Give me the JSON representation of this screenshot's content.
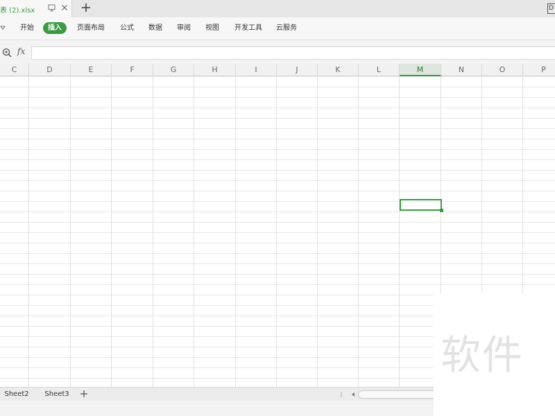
{
  "tabbar": {
    "doc_title": "表 (2).xlsx",
    "corner_label": "D"
  },
  "menu": {
    "items": [
      {
        "label": "开始"
      },
      {
        "label": "插入",
        "active": true
      },
      {
        "label": "页面布局"
      },
      {
        "label": "公式"
      },
      {
        "label": "数据"
      },
      {
        "label": "审阅"
      },
      {
        "label": "视图"
      },
      {
        "label": "开发工具"
      },
      {
        "label": "云服务"
      }
    ]
  },
  "formula": {
    "fx_label": "fx",
    "value": ""
  },
  "columns": [
    "C",
    "D",
    "E",
    "F",
    "G",
    "H",
    "I",
    "J",
    "K",
    "L",
    "M",
    "N",
    "O",
    "P"
  ],
  "selected_column": "M",
  "sheets": {
    "tabs": [
      "Sheet2",
      "Sheet3"
    ]
  },
  "watermark": {
    "text": "软件"
  },
  "colors": {
    "accent": "#3b9a43",
    "grid_line": "#e6e6e6",
    "header_bg": "#f1f1f1"
  }
}
